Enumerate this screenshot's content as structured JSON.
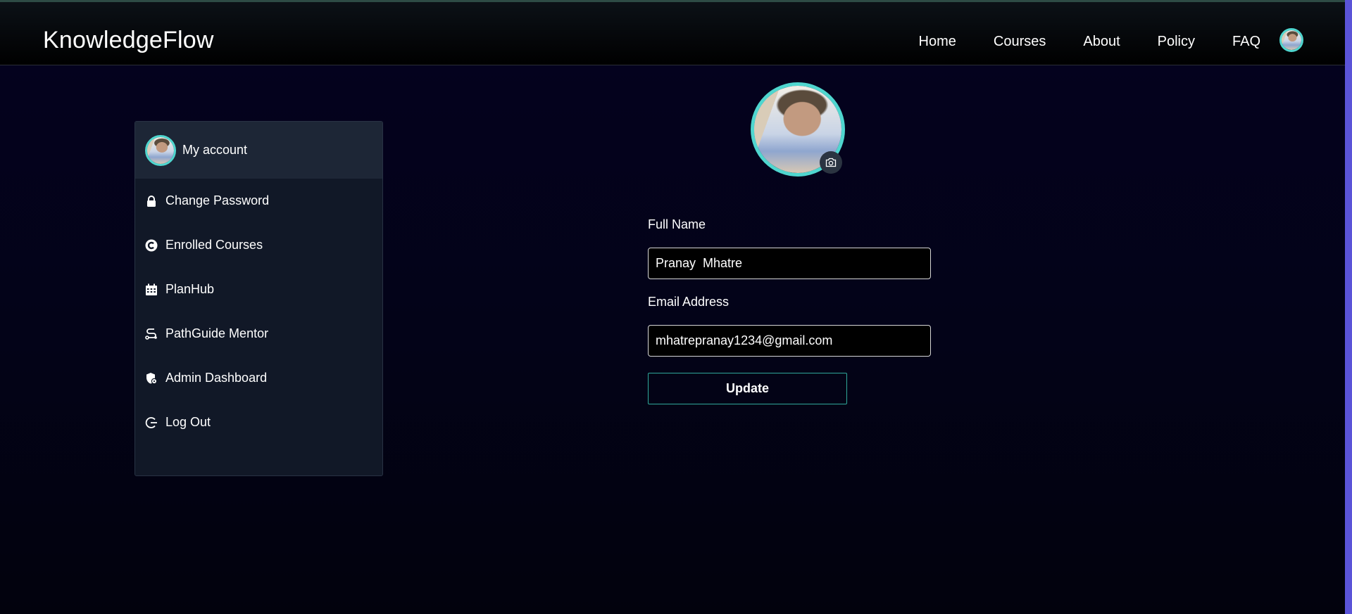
{
  "header": {
    "brand": "KnowledgeFlow",
    "nav": [
      "Home",
      "Courses",
      "About",
      "Policy",
      "FAQ"
    ]
  },
  "sidebar": {
    "account_label": "My account",
    "items": [
      {
        "label": "Change Password",
        "icon": "lock-icon"
      },
      {
        "label": "Enrolled Courses",
        "icon": "copyright-icon"
      },
      {
        "label": "PlanHub",
        "icon": "calendar-icon"
      },
      {
        "label": "PathGuide Mentor",
        "icon": "route-icon"
      },
      {
        "label": "Admin Dashboard",
        "icon": "shield-gear-icon"
      },
      {
        "label": "Log Out",
        "icon": "logout-icon"
      }
    ]
  },
  "profile": {
    "full_name_label": "Full Name",
    "full_name_value": "Pranay  Mhatre",
    "email_label": "Email Address",
    "email_value": "mhatrepranay1234@gmail.com",
    "update_label": "Update"
  },
  "colors": {
    "accent": "#4fd6cf",
    "button_border": "#2fa99b",
    "sidebar_bg": "#111827",
    "right_bar": "#5b54d8"
  }
}
